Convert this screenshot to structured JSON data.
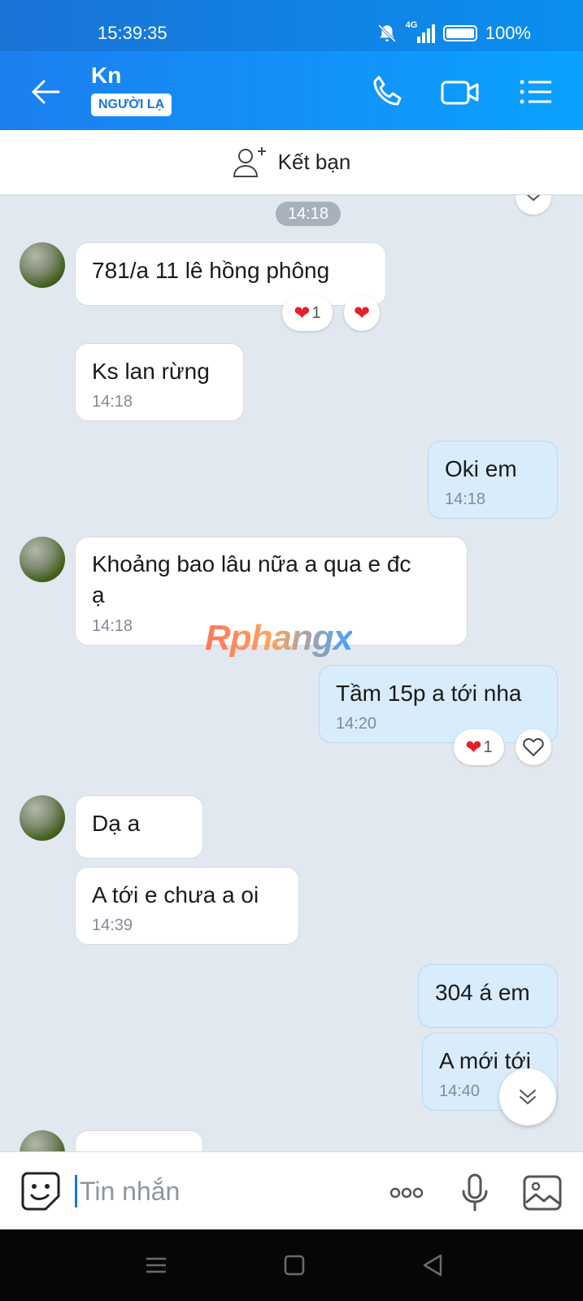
{
  "status": {
    "time": "15:39:35",
    "network": "4G",
    "battery": "100%"
  },
  "header": {
    "contact_name": "Kn",
    "badge": "NGƯỜI LẠ"
  },
  "friend_bar": {
    "label": "Kết bạn"
  },
  "watermark": "Rphangx",
  "messages": [
    {
      "type": "time",
      "text": "14:18"
    },
    {
      "dir": "in",
      "text": "781/a 11 lê hồng phông",
      "reactions": {
        "count": "1"
      }
    },
    {
      "dir": "in",
      "text": "Ks lan rừng",
      "time": "14:18"
    },
    {
      "dir": "out",
      "text": "Oki em",
      "time": "14:18"
    },
    {
      "dir": "in",
      "text_line1": "Khoảng bao lâu nữa a qua e đc",
      "text_line2": "ạ",
      "time": "14:18"
    },
    {
      "dir": "out",
      "text": "Tầm 15p a tới nha",
      "time": "14:20",
      "reactions": {
        "count": "1"
      }
    },
    {
      "dir": "in",
      "text": "Dạ a"
    },
    {
      "dir": "in",
      "text": "A tới e chưa a oi",
      "time": "14:39"
    },
    {
      "dir": "out",
      "text": "304 á em"
    },
    {
      "dir": "out",
      "text": "A mới tới",
      "time": "14:40"
    }
  ],
  "input": {
    "placeholder": "Tin nhắn"
  },
  "colors": {
    "header": "#1c7ff0",
    "out_bubble": "#d8ecfc",
    "chat_bg": "#e2e8ef"
  }
}
